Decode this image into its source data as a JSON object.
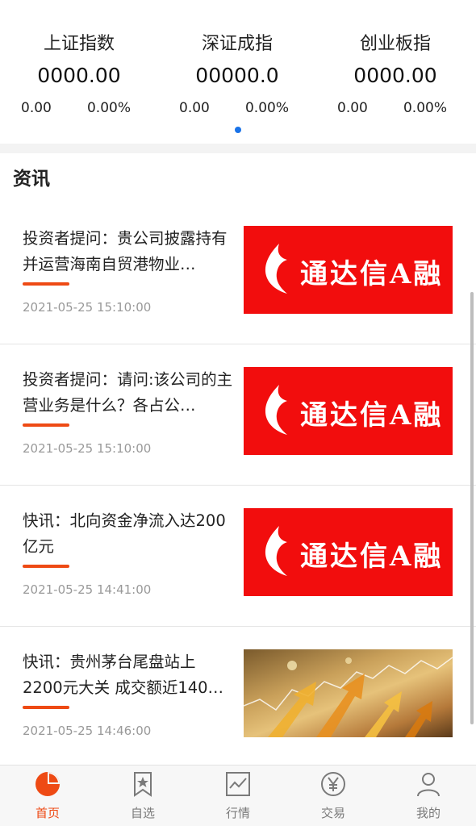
{
  "indices": [
    {
      "name": "上证指数",
      "value": "0000.00",
      "change": "0.00",
      "percent": "0.00%"
    },
    {
      "name": "深证成指",
      "value": "00000.0",
      "change": "0.00",
      "percent": "0.00%"
    },
    {
      "name": "创业板指",
      "value": "0000.00",
      "change": "0.00",
      "percent": "0.00%"
    }
  ],
  "section_title": "资讯",
  "news": [
    {
      "headline": "投资者提问：贵公司披露持有并运营海南自贸港物业…",
      "time": "2021-05-25 15:10:00",
      "image": "brand",
      "image_text": "通达信A融"
    },
    {
      "headline": "投资者提问：请问:该公司的主营业务是什么？各占公…",
      "time": "2021-05-25 15:10:00",
      "image": "brand",
      "image_text": "通达信A融"
    },
    {
      "headline": "快讯：北向资金净流入达200亿元",
      "time": "2021-05-25 14:41:00",
      "image": "brand",
      "image_text": "通达信A融"
    },
    {
      "headline": "快讯：贵州茅台尾盘站上2200元大关 成交额近140…",
      "time": "2021-05-25 14:46:00",
      "image": "photo",
      "image_text": ""
    }
  ],
  "tabs": [
    {
      "label": "首页",
      "icon": "pie-chart-icon",
      "active": true
    },
    {
      "label": "自选",
      "icon": "bookmark-star-icon",
      "active": false
    },
    {
      "label": "行情",
      "icon": "line-chart-icon",
      "active": false
    },
    {
      "label": "交易",
      "icon": "yen-circle-icon",
      "active": false
    },
    {
      "label": "我的",
      "icon": "person-icon",
      "active": false
    }
  ],
  "colors": {
    "accent": "#ee4a14",
    "brand_red": "#f20d0d",
    "page_dot": "#1a73e8"
  }
}
